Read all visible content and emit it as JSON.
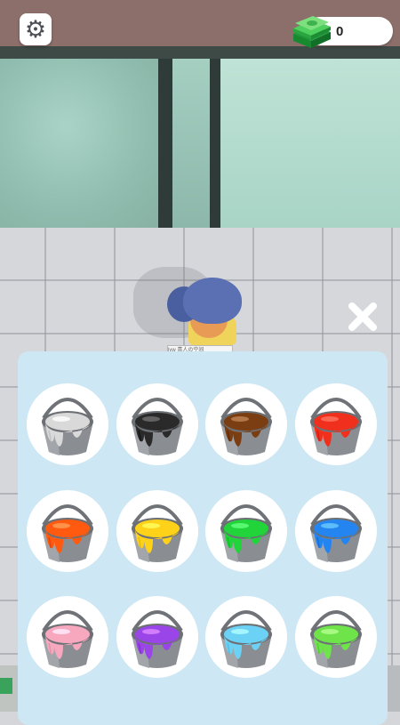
{
  "hud": {
    "settings_icon": "gear-icon",
    "money_icon": "cash-stack-icon",
    "money_value": "0"
  },
  "character": {
    "nametag": "lvw 喜人の空间"
  },
  "close_icon": "close-x-icon",
  "palette": {
    "buckets": [
      {
        "name": "white",
        "color": "#d9d9d9"
      },
      {
        "name": "black",
        "color": "#2a2a2a"
      },
      {
        "name": "brown",
        "color": "#7a3e12"
      },
      {
        "name": "red",
        "color": "#f0301c"
      },
      {
        "name": "orange",
        "color": "#ff5a10"
      },
      {
        "name": "yellow",
        "color": "#ffd21a"
      },
      {
        "name": "green",
        "color": "#20d43a"
      },
      {
        "name": "blue",
        "color": "#2585f0"
      },
      {
        "name": "pink",
        "color": "#f7a8bf"
      },
      {
        "name": "purple",
        "color": "#9a45e8"
      },
      {
        "name": "light-blue",
        "color": "#6cd2f5"
      },
      {
        "name": "lime",
        "color": "#6ee34a"
      }
    ]
  }
}
